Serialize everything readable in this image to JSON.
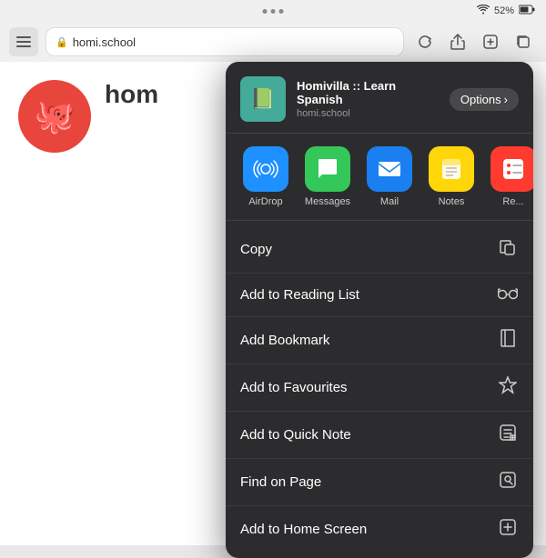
{
  "statusBar": {
    "wifi": "52%",
    "battery": "52%"
  },
  "addressBar": {
    "url": "homi.school",
    "lock": "🔒"
  },
  "pageContent": {
    "siteName": "hom"
  },
  "shareSheet": {
    "siteTitle": "Homivilla :: Learn Spanish",
    "siteUrl": "homi.school",
    "optionsLabel": "Options",
    "apps": [
      {
        "name": "AirDrop",
        "type": "airdrop"
      },
      {
        "name": "Messages",
        "type": "messages"
      },
      {
        "name": "Mail",
        "type": "mail"
      },
      {
        "name": "Notes",
        "type": "notes"
      },
      {
        "name": "Re...",
        "type": "reminders"
      }
    ],
    "actions": [
      {
        "label": "Copy",
        "icon": "copy"
      },
      {
        "label": "Add to Reading List",
        "icon": "glasses"
      },
      {
        "label": "Add Bookmark",
        "icon": "book"
      },
      {
        "label": "Add to Favourites",
        "icon": "star"
      },
      {
        "label": "Add to Quick Note",
        "icon": "note"
      },
      {
        "label": "Find on Page",
        "icon": "find"
      },
      {
        "label": "Add to Home Screen",
        "icon": "plus-square"
      }
    ]
  }
}
